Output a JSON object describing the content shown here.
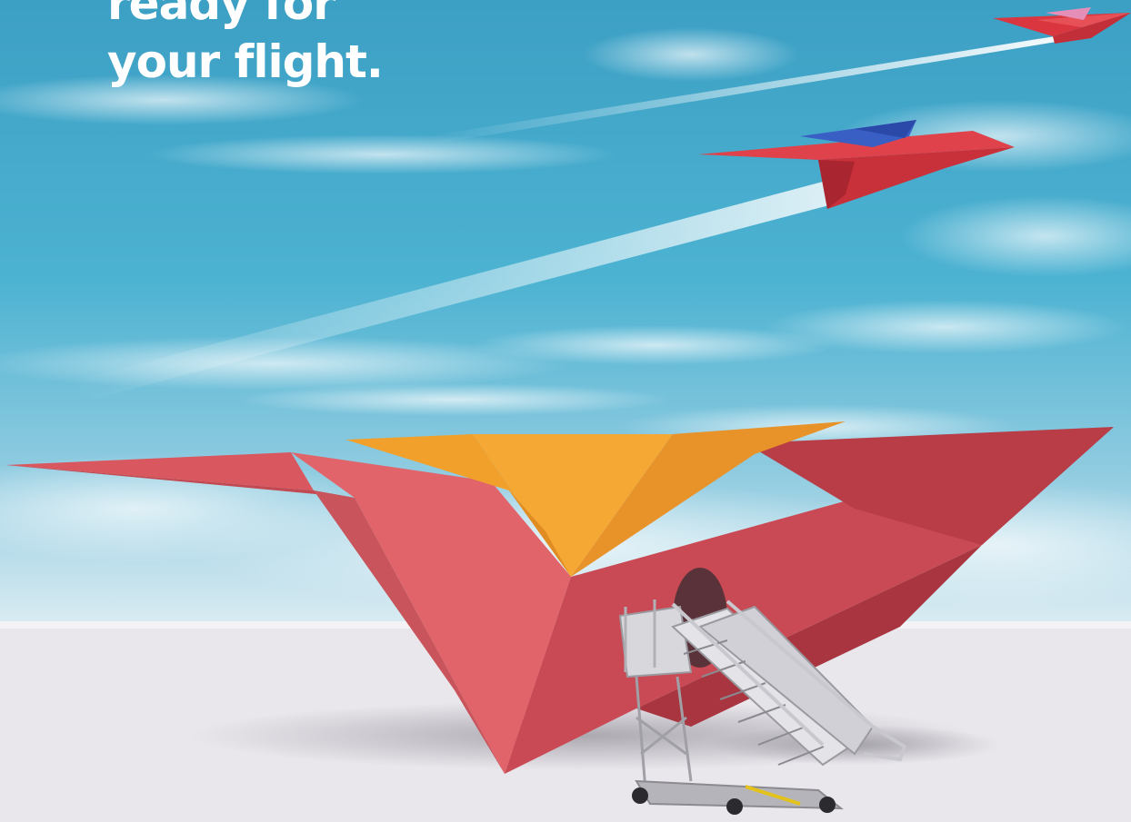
{
  "headline": {
    "line1": "ready for",
    "line2": "your flight."
  },
  "colors": {
    "sky_top": "#3fa3c6",
    "sky_mid": "#52b6d3",
    "sky_horizon": "#cfe6f0",
    "ground": "#e9e6ec",
    "plane_red": "#e0525a",
    "plane_red_dark": "#b83a44",
    "plane_orange": "#f2a02c",
    "plane_blue": "#3a5fc4",
    "plane_pink": "#e58fb8",
    "headline_text": "#ffffff"
  },
  "scene": {
    "elements": [
      "sky",
      "clouds",
      "contrail-small",
      "contrail-medium",
      "paper-plane-small",
      "paper-plane-medium",
      "paper-plane-large",
      "boarding-stairs",
      "tarmac"
    ]
  }
}
